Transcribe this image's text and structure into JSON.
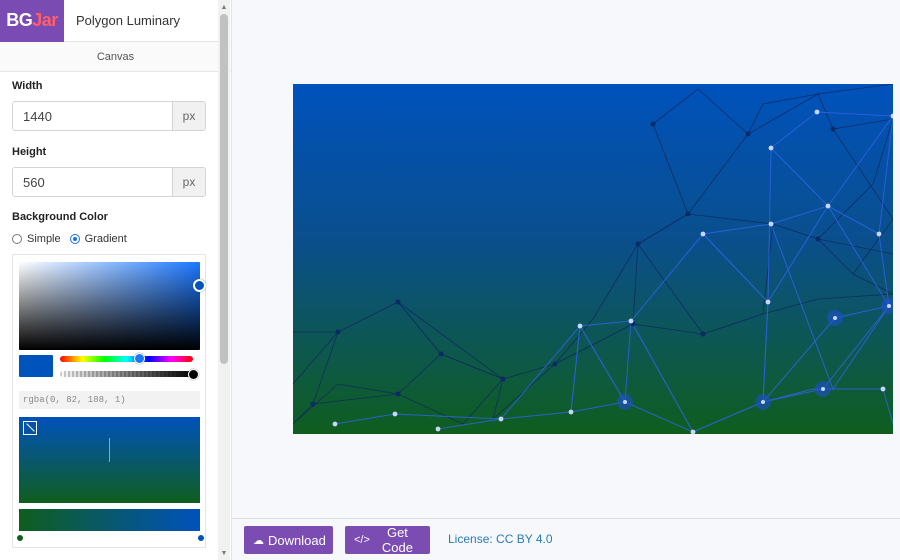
{
  "logo": {
    "part1": "BG",
    "part2": "Jar"
  },
  "app_title": "Polygon Luminary",
  "section_tab": "Canvas",
  "width": {
    "label": "Width",
    "value": "1440",
    "unit": "px"
  },
  "height": {
    "label": "Height",
    "value": "560",
    "unit": "px"
  },
  "background": {
    "label": "Background Color",
    "options": [
      "Simple",
      "Gradient"
    ],
    "selected": "Gradient",
    "current_color_text": "rgba(0, 82, 188, 1)",
    "picker_color": "#0052bc",
    "gradient_colors": [
      "#0052bc",
      "#0f5e1e"
    ]
  },
  "buttons": {
    "download": "Download",
    "get_code": "Get Code"
  },
  "license": "License: CC BY 4.0",
  "icons": {
    "download": "cloud-download-icon",
    "code": "code-icon"
  }
}
